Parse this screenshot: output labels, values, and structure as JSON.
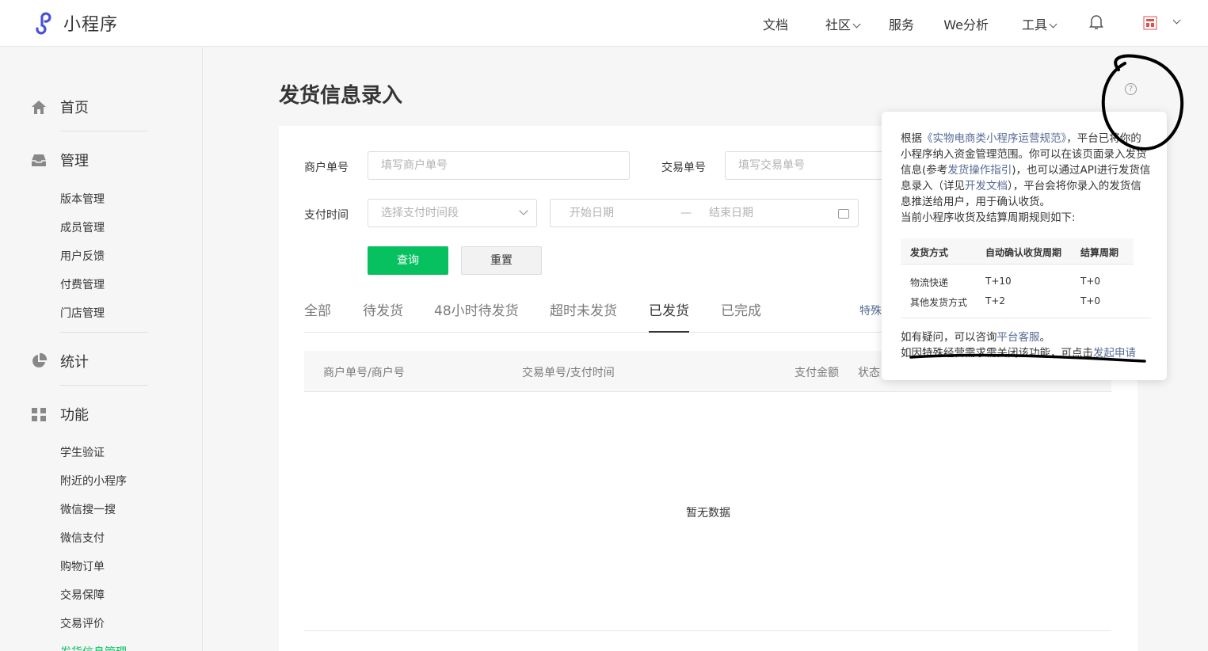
{
  "app": {
    "logo_text": "小程序"
  },
  "topnav": {
    "items": [
      "文档",
      "社区",
      "服务",
      "We分析",
      "工具"
    ]
  },
  "sidebar": {
    "sections": [
      {
        "label": "首页",
        "icon": "home-icon"
      },
      {
        "label": "管理",
        "icon": "inbox-icon",
        "items": [
          "版本管理",
          "成员管理",
          "用户反馈",
          "付费管理",
          "门店管理"
        ]
      },
      {
        "label": "统计",
        "icon": "pie-chart-icon"
      },
      {
        "label": "功能",
        "icon": "grid-icon",
        "items": [
          "学生验证",
          "附近的小程序",
          "微信搜一搜",
          "微信支付",
          "购物订单",
          "交易保障",
          "交易评价",
          "发货信息管理"
        ]
      }
    ]
  },
  "page": {
    "title": "发货信息录入"
  },
  "filters": {
    "merchant_label": "商户单号",
    "merchant_placeholder": "填写商户单号",
    "trade_label": "交易单号",
    "trade_placeholder": "填写交易单号",
    "paytime_label": "支付时间",
    "paytime_placeholder": "选择支付时间段",
    "start_date": "开始日期",
    "date_sep": "—",
    "end_date": "结束日期",
    "query_button": "查询",
    "reset_button": "重置"
  },
  "tabs": {
    "items": [
      "全部",
      "待发货",
      "48小时待发货",
      "超时未发货",
      "已发货",
      "已完成"
    ],
    "active": "已发货",
    "right_link": "特殊"
  },
  "table": {
    "columns": [
      "商户单号/商户号",
      "交易单号/支付时间",
      "支付金额",
      "状态"
    ],
    "empty_text": "暂无数据"
  },
  "popover": {
    "p1_a": "根据",
    "p1_link1": "《实物电商类小程序运营规范》",
    "p1_b": "，平台已将你的小程序纳入资金管理范围。你可以在该页面录入发货信息(参考",
    "p1_link2": "发货操作指引",
    "p1_c": ")，也可以通过API进行发货信息录入（详见",
    "p1_link3": "开发文档",
    "p1_d": "），平台会将你录入的发货信息推送给用户，用于确认收货。",
    "p2": "当前小程序收货及结算周期规则如下:",
    "table_headers": [
      "发货方式",
      "自动确认收货周期",
      "结算周期"
    ],
    "table_rows": [
      [
        "物流快递",
        "T+10",
        "T+0"
      ],
      [
        "其他发货方式",
        "T+2",
        "T+0"
      ]
    ],
    "foot1_a": "如有疑问，可以咨询",
    "foot1_link": "平台客服",
    "foot1_b": "。",
    "foot2_a": "如因特殊经营需求需关闭该功能，可点击",
    "foot2_link": "发起申请"
  },
  "colors": {
    "accent": "#07c160",
    "link": "#576b95"
  }
}
